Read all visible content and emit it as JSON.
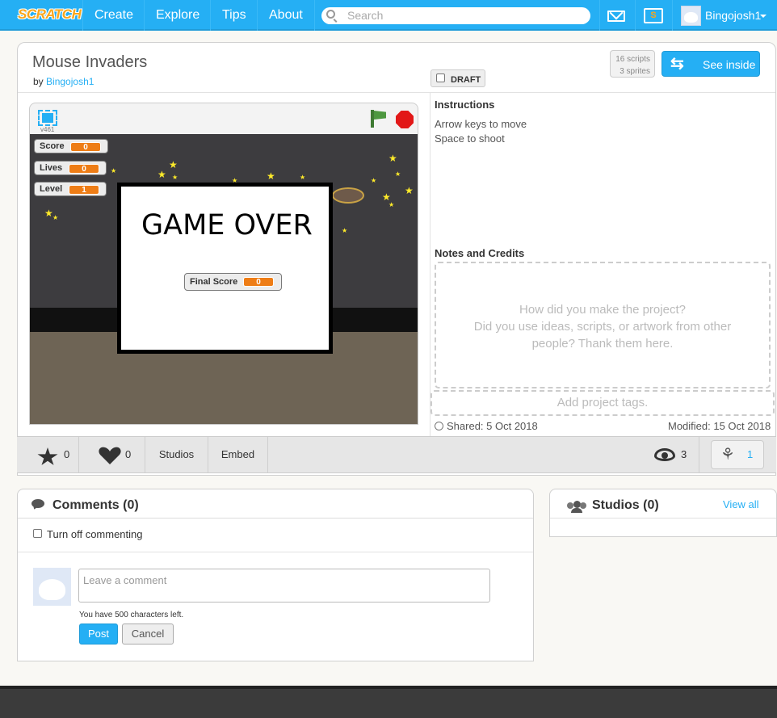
{
  "nav": {
    "logo": "SCRATCH",
    "links": [
      "Create",
      "Explore",
      "Tips",
      "About"
    ],
    "search_placeholder": "Search",
    "mystuff_letter": "S",
    "username": "Bingojosh1"
  },
  "project": {
    "title": "Mouse Invaders",
    "by_prefix": "by",
    "author": "Bingojosh1",
    "scripts_count": "16 scripts",
    "sprites_count": "3 sprites",
    "see_inside": "See inside",
    "draft": "DRAFT"
  },
  "player": {
    "version": "v461",
    "monitors": [
      {
        "label": "Score",
        "value": "0"
      },
      {
        "label": "Lives",
        "value": "0"
      },
      {
        "label": "Level",
        "value": "1"
      }
    ],
    "game_over": "GAME OVER",
    "final_score_label": "Final Score",
    "final_score_value": "0"
  },
  "info": {
    "instructions_heading": "Instructions",
    "instructions_line1": "Arrow keys to move",
    "instructions_line2": "Space to shoot",
    "notes_heading": "Notes and Credits",
    "notes_placeholder_1": "How did you make the project?",
    "notes_placeholder_2": "Did you use ideas, scripts, or artwork from other",
    "notes_placeholder_3": "people? Thank them here.",
    "tags_placeholder": "Add project tags.",
    "shared": "Shared: 5 Oct 2018",
    "modified": "Modified: 15 Oct 2018"
  },
  "stats": {
    "favorites": "0",
    "loves": "0",
    "studios_label": "Studios",
    "embed_label": "Embed",
    "views": "3",
    "remixes": "1"
  },
  "comments": {
    "heading": "Comments (0)",
    "turn_off": "Turn off commenting",
    "placeholder": "Leave a comment",
    "chars_left": "You have 500 characters left.",
    "post": "Post",
    "cancel": "Cancel"
  },
  "studios": {
    "heading": "Studios (0)",
    "view_all": "View all"
  },
  "colors": {
    "nav": "#25aff4",
    "accent_orange": "#ee7d16"
  }
}
